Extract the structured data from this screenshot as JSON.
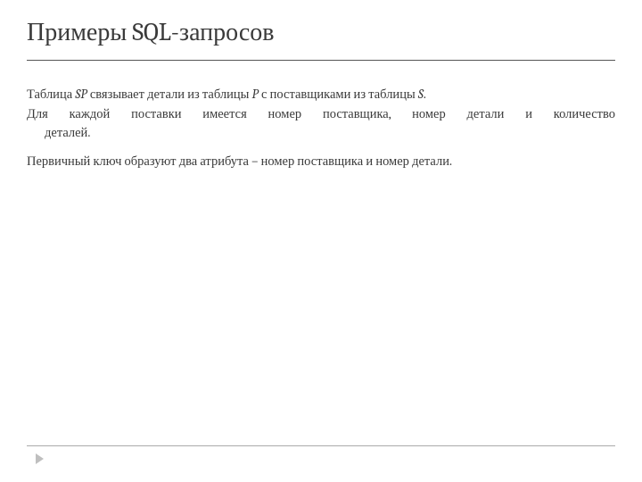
{
  "slide": {
    "title": "Примеры SQL-запросов",
    "p1_a": "Таблица ",
    "p1_sp": "SP",
    "p1_b": " связывает детали из таблицы ",
    "p1_p": "P",
    "p1_c": " с поставщиками из таблицы ",
    "p1_s": "S",
    "p1_d": ".",
    "p2_line1": "Для каждой поставки имеется номер поставщика, номер детали и количество",
    "p2_line2": "деталей.",
    "p3": "Первичный ключ образуют два атрибута – номер поставщика и номер детали."
  }
}
